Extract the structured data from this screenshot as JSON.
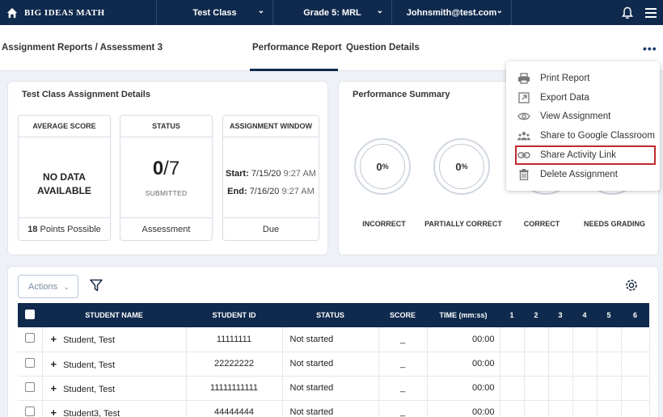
{
  "topbar": {
    "brand": "BIG IDEAS MATH",
    "class_select": "Test Class",
    "grade_select": "Grade 5: MRL",
    "user_select": "Johnsmith@test.com"
  },
  "subheader": {
    "breadcrumb": "Assignment Reports / Assessment 3",
    "tabs": [
      "Performance Report",
      "Question Details"
    ],
    "more": "•••"
  },
  "details": {
    "title": "Test Class Assignment Details",
    "average_score": {
      "header": "AVERAGE SCORE",
      "line1": "NO DATA",
      "line2": "AVAILABLE",
      "points": "18",
      "points_label": "Points Possible"
    },
    "status": {
      "header": "STATUS",
      "submitted_num": "0",
      "total": "/7",
      "submitted_label": "SUBMITTED",
      "footer": "Assessment"
    },
    "window": {
      "header": "ASSIGNMENT WINDOW",
      "start_label": "Start:",
      "start_date": "7/15/20",
      "start_time": "9:27 AM",
      "end_label": "End:",
      "end_date": "7/16/20",
      "end_time": "9:27 AM",
      "footer": "Due"
    }
  },
  "summary": {
    "title": "Performance Summary",
    "items": [
      {
        "label": "INCORRECT",
        "value": "0",
        "unit": "%"
      },
      {
        "label": "PARTIALLY CORRECT",
        "value": "0",
        "unit": "%"
      },
      {
        "label": "CORRECT"
      },
      {
        "label": "NEEDS GRADING"
      }
    ]
  },
  "menu": {
    "items": [
      {
        "label": "Print Report",
        "icon": "printer-icon"
      },
      {
        "label": "Export Data",
        "icon": "export-icon"
      },
      {
        "label": "View Assignment",
        "icon": "eye-icon"
      },
      {
        "label": "Share to Google Classroom",
        "icon": "people-icon"
      },
      {
        "label": "Share Activity Link",
        "icon": "link-icon"
      },
      {
        "label": "Delete Assignment",
        "icon": "trash-icon"
      }
    ],
    "highlight_color": "#c0272d"
  },
  "table": {
    "actions_label": "Actions",
    "headers": [
      "STUDENT NAME",
      "STUDENT ID",
      "STATUS",
      "SCORE",
      "TIME (mm:ss)",
      "1",
      "2",
      "3",
      "4",
      "5",
      "6"
    ],
    "rows": [
      {
        "name": "Student, Test",
        "id": "11111111",
        "status": "Not started",
        "score": "_",
        "time": "00:00"
      },
      {
        "name": "Student, Test",
        "id": "22222222",
        "status": "Not started",
        "score": "_",
        "time": "00:00"
      },
      {
        "name": "Student, Test",
        "id": "11111111111",
        "status": "Not started",
        "score": "_",
        "time": "00:00"
      },
      {
        "name": "Student3, Test",
        "id": "44444444",
        "status": "Not started",
        "score": "_",
        "time": "00:00"
      }
    ]
  },
  "colors": {
    "navy": "#0f2a4d",
    "background": "#eef2f7"
  }
}
